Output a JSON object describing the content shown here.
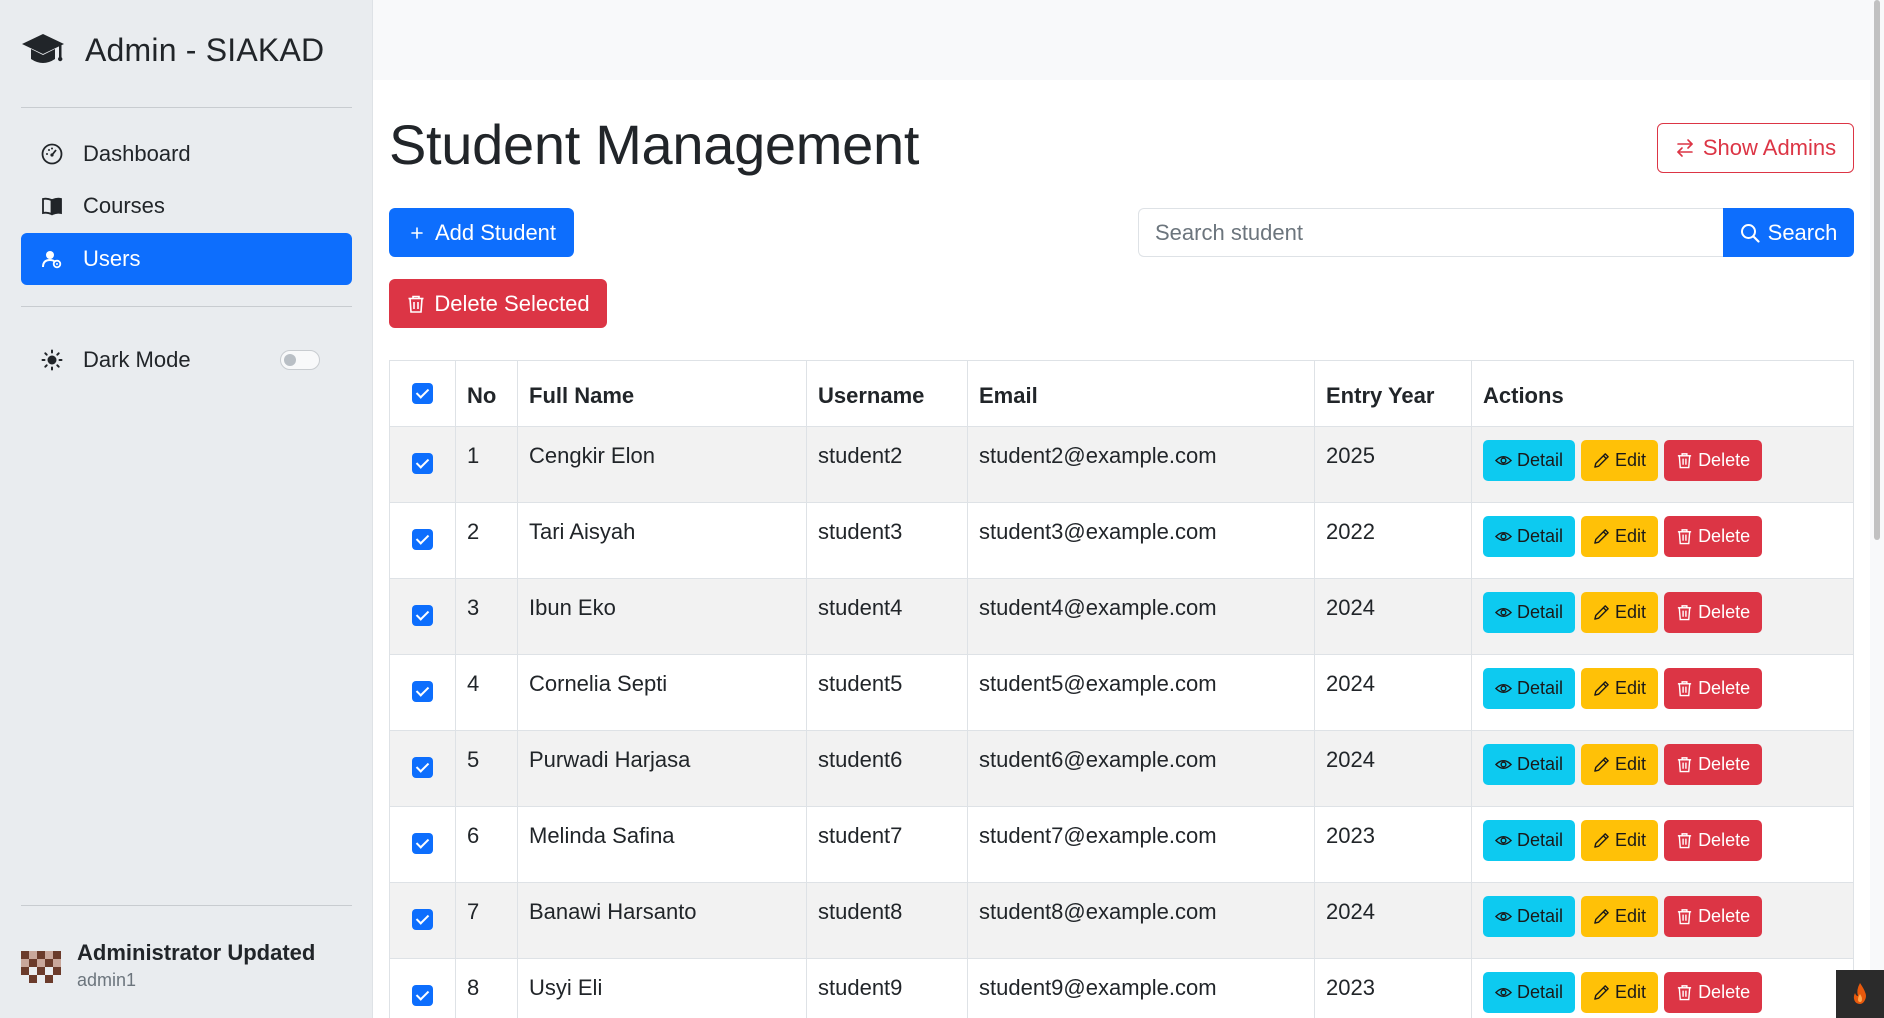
{
  "brand": {
    "title": "Admin - SIAKAD"
  },
  "sidebar": {
    "items": [
      {
        "label": "Dashboard",
        "icon": "speedometer-icon"
      },
      {
        "label": "Courses",
        "icon": "book-icon"
      },
      {
        "label": "Users",
        "icon": "users-icon",
        "active": true
      }
    ],
    "dark_mode": {
      "label": "Dark Mode",
      "enabled": false
    },
    "user": {
      "name": "Administrator Updated",
      "login": "admin1"
    }
  },
  "page": {
    "title": "Student Management",
    "show_admins_label": "Show Admins",
    "add_student_label": "Add Student",
    "delete_selected_label": "Delete Selected",
    "search": {
      "placeholder": "Search student",
      "value": "",
      "button_label": "Search"
    }
  },
  "table": {
    "headers": [
      "No",
      "Full Name",
      "Username",
      "Email",
      "Entry Year",
      "Actions"
    ],
    "actions": {
      "detail": "Detail",
      "edit": "Edit",
      "delete": "Delete"
    },
    "rows": [
      {
        "no": "1",
        "name": "Cengkir Elon",
        "username": "student2",
        "email": "student2@example.com",
        "year": "2025"
      },
      {
        "no": "2",
        "name": "Tari Aisyah",
        "username": "student3",
        "email": "student3@example.com",
        "year": "2022"
      },
      {
        "no": "3",
        "name": "Ibun Eko",
        "username": "student4",
        "email": "student4@example.com",
        "year": "2024"
      },
      {
        "no": "4",
        "name": "Cornelia Septi",
        "username": "student5",
        "email": "student5@example.com",
        "year": "2024"
      },
      {
        "no": "5",
        "name": "Purwadi Harjasa",
        "username": "student6",
        "email": "student6@example.com",
        "year": "2024"
      },
      {
        "no": "6",
        "name": "Melinda Safina",
        "username": "student7",
        "email": "student7@example.com",
        "year": "2023"
      },
      {
        "no": "7",
        "name": "Banawi Harsanto",
        "username": "student8",
        "email": "student8@example.com",
        "year": "2024"
      },
      {
        "no": "8",
        "name": "Usyi Eli",
        "username": "student9",
        "email": "student9@example.com",
        "year": "2023"
      }
    ]
  },
  "colors": {
    "primary": "#0d6efd",
    "danger": "#dc3545",
    "info": "#0dcaf0",
    "warning": "#ffc107",
    "sidebar_bg": "#e9ecef"
  }
}
